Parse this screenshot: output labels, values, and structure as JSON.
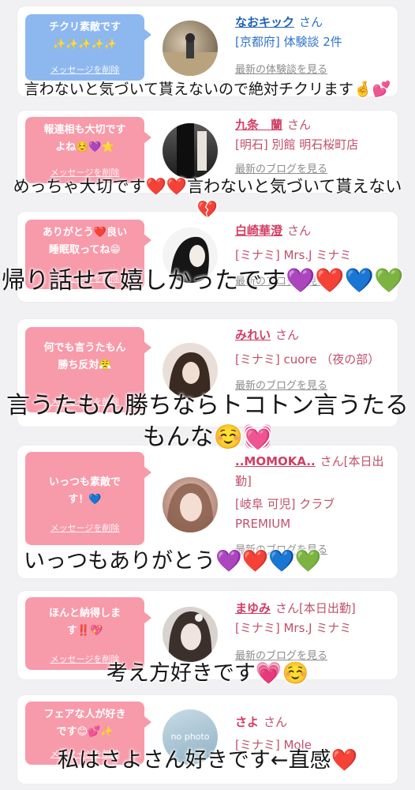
{
  "cards": [
    {
      "bubble_color": "#8db7ef",
      "message": "チクリ素敵です\n✨✨✨✨✨",
      "delete_label": "メッセージを削除",
      "name": "なおキック",
      "honorific": "さん",
      "sub": "[京都府] 体験談 2件",
      "more": "最新の体験談を見る"
    },
    {
      "bubble_color": "#f79aaa",
      "message": "報連相も大切です\nよね☺️💜⭐",
      "delete_label": "メッセージを削除",
      "name": "九条　蘭",
      "honorific": "さん",
      "sub": "[明石] 別館 明石桜町店",
      "more": "最新のブログを見る"
    },
    {
      "bubble_color": "#f79aaa",
      "message": "ありがとう❤️良い\n睡眠取ってね😁",
      "delete_label": "メッセージを削除",
      "name": "白崎華澄",
      "honorific": "さん",
      "sub": "[ミナミ] Mrs.J ミナミ",
      "more": "最新のブログを見る"
    },
    {
      "bubble_color": "#f79aaa",
      "message": "何でも言うたもん\n勝ち反対😤",
      "delete_label": "メッセージを削除",
      "name": "みれい",
      "honorific": "さん",
      "sub": "[ミナミ] cuore （夜の部）",
      "more": "最新のブログを見る"
    },
    {
      "bubble_color": "#f79aaa",
      "message": "いっつも素敵で\nす！💙",
      "delete_label": "メッセージを削除",
      "name": "..MOMOKA..",
      "honorific": "さん[本日出勤]",
      "sub": "[岐阜 可児] クラブ PREMIUM",
      "more": "最新のブログを見る"
    },
    {
      "bubble_color": "#f79aaa",
      "message": "ほんと納得しま\nす‼️💖",
      "delete_label": "メッセージを削除",
      "name": "まゆみ",
      "honorific": "さん[本日出勤]",
      "sub": "[ミナミ] Mrs.J ミナミ",
      "more": "最新のブログを見る"
    },
    {
      "bubble_color": "#f79aaa",
      "message": "フェアな人が好き\nです😊💕✨",
      "delete_label": "メッセージを削除",
      "name": "さよ",
      "honorific": "さん",
      "sub": "[ミナミ] Mole",
      "more": "no photo"
    }
  ],
  "overlays": [
    "言わないと気づいて貰えないので絶対チクリます🤞💕",
    "めっちゃ大切です❤️❤️言わないと気づいて貰えない💔",
    "帰り話せて嬉しかったです💜❤️💙💚",
    "言うたもん勝ちならトコトン言うたるもんな☺️💓",
    "いっつもありがとう💜❤️💙💚",
    "考え方好きです💗☺️",
    "私はさよさん好きです←直感❤️"
  ]
}
